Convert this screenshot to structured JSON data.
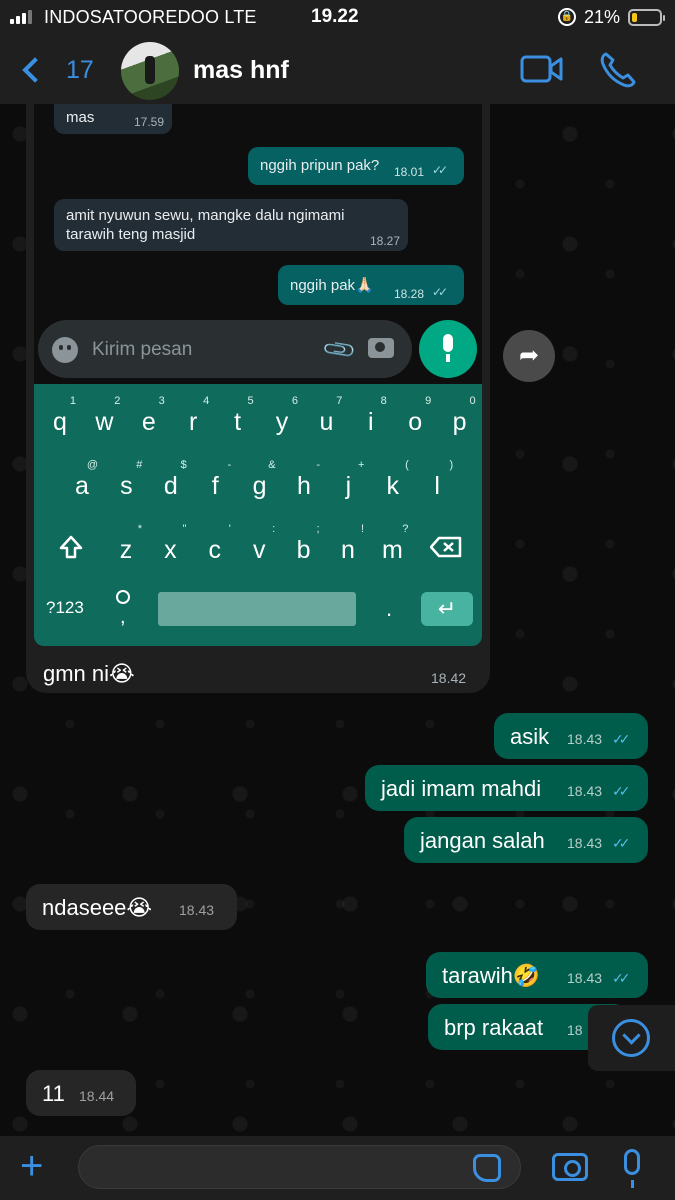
{
  "status_bar": {
    "carrier": "INDOSATOOREDOO  LTE",
    "time": "19.22",
    "battery_percent": "21%",
    "battery_level": 0.21
  },
  "header": {
    "back_count": "17",
    "contact_name": "mas hnf"
  },
  "embedded_screenshot": {
    "messages": [
      {
        "text": "mas",
        "time": "17.59",
        "dir": "in"
      },
      {
        "text": "nggih pripun pak?",
        "time": "18.01",
        "dir": "out"
      },
      {
        "text_line1": "amit nyuwun sewu, mangke dalu ngimami",
        "text_line2": "tarawih teng masjid",
        "time": "18.27",
        "dir": "in"
      },
      {
        "text": "nggih pak🙏🏻",
        "time": "18.28",
        "dir": "out"
      }
    ],
    "input_placeholder": "Kirim pesan",
    "keyboard": {
      "row1": [
        [
          "q",
          "1"
        ],
        [
          "w",
          "2"
        ],
        [
          "e",
          "3"
        ],
        [
          "r",
          "4"
        ],
        [
          "t",
          "5"
        ],
        [
          "y",
          "6"
        ],
        [
          "u",
          "7"
        ],
        [
          "i",
          "8"
        ],
        [
          "o",
          "9"
        ],
        [
          "p",
          "0"
        ]
      ],
      "row2": [
        [
          "a",
          "@"
        ],
        [
          "s",
          "#"
        ],
        [
          "d",
          "$"
        ],
        [
          "f",
          "-"
        ],
        [
          "g",
          "&"
        ],
        [
          "h",
          "-"
        ],
        [
          "j",
          "+"
        ],
        [
          "k",
          "("
        ],
        [
          "l",
          ")"
        ]
      ],
      "row3": [
        [
          "z",
          "*"
        ],
        [
          "x",
          "\""
        ],
        [
          "c",
          "'"
        ],
        [
          "v",
          ":"
        ],
        [
          "b",
          ";"
        ],
        [
          "n",
          "!"
        ],
        [
          "m",
          "?"
        ]
      ],
      "symbols_label": "?123",
      "comma": ",",
      "period": "."
    },
    "caption": {
      "text": "gmn ni😭",
      "time": "18.42"
    }
  },
  "messages": [
    {
      "text": "asik",
      "time": "18.43",
      "dir": "out"
    },
    {
      "text": "jadi imam mahdi",
      "time": "18.43",
      "dir": "out"
    },
    {
      "text": "jangan salah",
      "time": "18.43",
      "dir": "out"
    },
    {
      "text": "ndaseee😭",
      "time": "18.43",
      "dir": "in"
    },
    {
      "text": "tarawih🤣",
      "time": "18.43",
      "dir": "out"
    },
    {
      "text": "brp rakaat",
      "time": "18",
      "dir": "out"
    },
    {
      "text": "11",
      "time": "18.44",
      "dir": "in"
    }
  ],
  "colors": {
    "accent": "#3b8fe0",
    "outgoing": "#005c4b",
    "incoming": "#262626",
    "keyboard": "#0f6b5c",
    "read_ticks": "#53bdeb"
  }
}
